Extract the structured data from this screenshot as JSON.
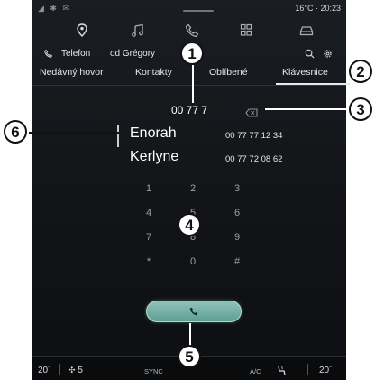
{
  "status": {
    "signals": "◢ ✱ ✉",
    "temp_time": "16°C · 20:23"
  },
  "nav": {
    "icons": [
      "location-pin-icon",
      "music-note-icon",
      "phone-icon",
      "apps-grid-icon",
      "car-icon"
    ]
  },
  "subheader": {
    "title": "Telefon",
    "device": "od Grégory"
  },
  "tabs": {
    "recent": "Nedávný hovor",
    "contacts": "Kontakty",
    "favorites": "Oblíbené",
    "keypad": "Klávesnice"
  },
  "dialer": {
    "number": "00 77 7",
    "suggestions": [
      {
        "name": "Enorah",
        "number": "00 77 77 12 34"
      },
      {
        "name": "Kerlyne",
        "number": "00 77 72 08 62"
      }
    ],
    "keys": [
      "1",
      "2",
      "3",
      "4",
      "5",
      "6",
      "7",
      "8",
      "9",
      "*",
      "0",
      "#"
    ]
  },
  "bottom_bar": {
    "temp_left": "20",
    "temp_left_unit": "°",
    "fan": "5",
    "sync": "SYNC",
    "ac": "A/C",
    "temp_right": "20",
    "temp_right_unit": "°"
  },
  "callouts": {
    "c1": "1",
    "c2": "2",
    "c3": "3",
    "c4": "4",
    "c5": "5",
    "c6": "6"
  },
  "colors": {
    "screen_bg": "#111316",
    "accent_call": "#6fb0a4",
    "text": "#ffffff",
    "muted": "#9aa0a6"
  }
}
